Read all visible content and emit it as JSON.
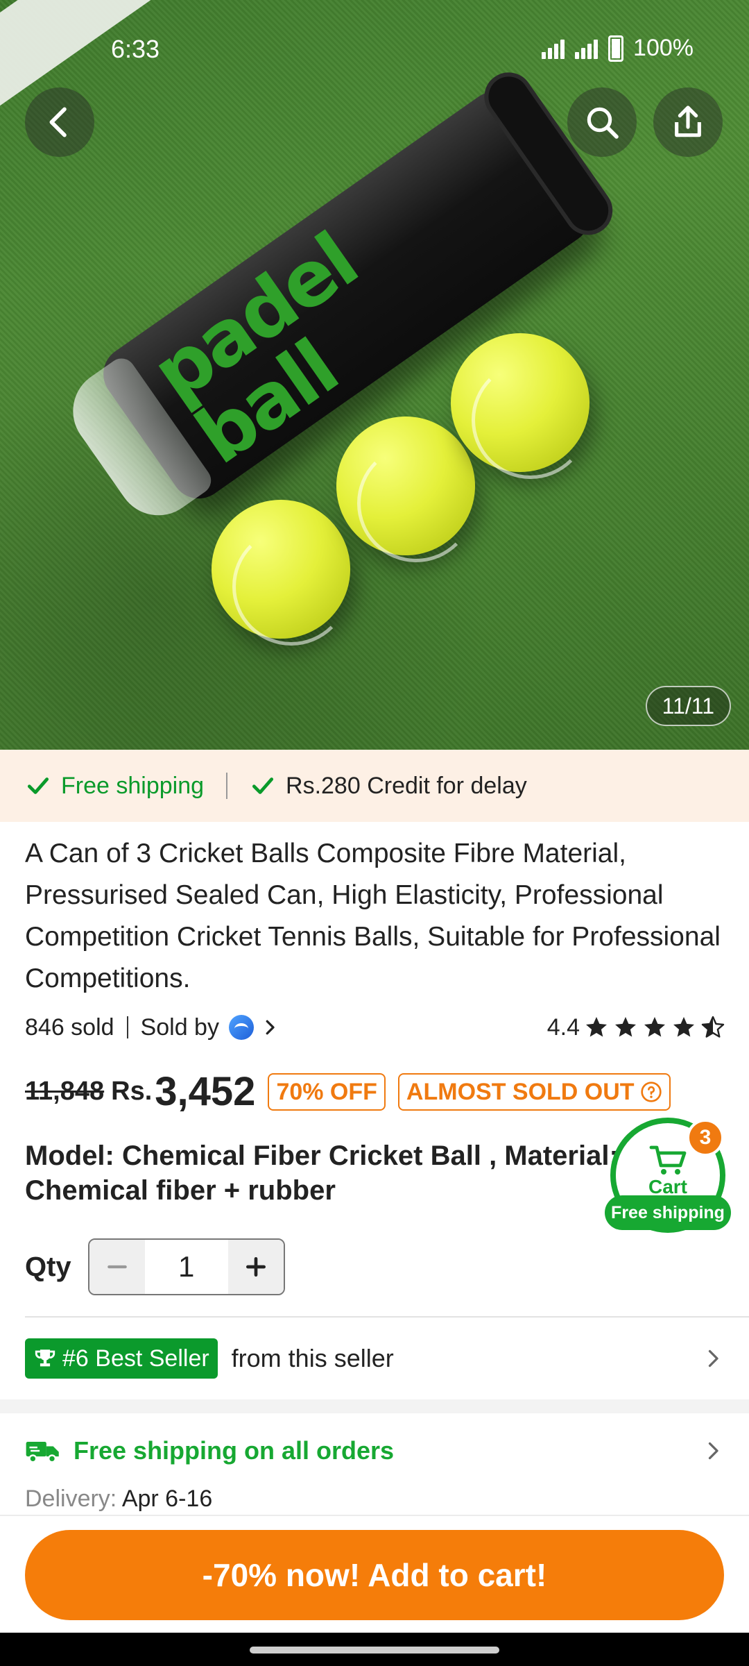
{
  "status_bar": {
    "time": "6:33",
    "battery": "100%"
  },
  "gallery": {
    "counter": "11/11",
    "can_text": "padel\nball"
  },
  "ship_strip": {
    "free_shipping": "Free shipping",
    "credit": "Rs.280 Credit for delay"
  },
  "product": {
    "title": "A Can of 3 Cricket Balls Composite Fibre Material, Pressurised Sealed Can, High Elasticity, Professional Competition Cricket Tennis Balls, Suitable for Professional Competitions.",
    "sold": "846 sold",
    "sold_by": "Sold by",
    "rating": "4.4",
    "rating_value": 4.4,
    "old_price": "11,848",
    "currency": "Rs.",
    "price": "3,452",
    "discount": "70% OFF",
    "stock_tag": "ALMOST SOLD OUT",
    "model": "Model: Chemical Fiber Cricket Ball , Material: Chemical fiber + rubber"
  },
  "cart": {
    "label": "Cart",
    "count": "3",
    "free": "Free shipping"
  },
  "quantity": {
    "label": "Qty",
    "value": "1"
  },
  "best_seller": {
    "badge": "#6 Best Seller",
    "text": "from this seller"
  },
  "shipping": {
    "headline": "Free shipping on all orders",
    "delivery_label": "Delivery:",
    "delivery_dates": "Apr 6-16"
  },
  "cta": {
    "label": "-70% now! Add to cart!"
  },
  "colors": {
    "accent_orange": "#f57d0a",
    "green": "#17a832",
    "strip_bg": "#fdf0e5"
  }
}
